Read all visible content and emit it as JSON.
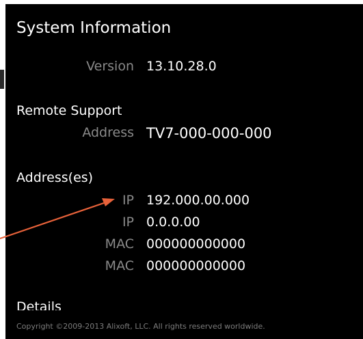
{
  "panel": {
    "title": "System Information",
    "version_label": "Version",
    "version_value": "13.10.28.0",
    "remote_support": {
      "heading": "Remote Support",
      "address_label": "Address",
      "address_value": "TV7-000-000-000"
    },
    "addresses": {
      "heading": "Address(es)",
      "rows": [
        {
          "label": "IP",
          "value": "192.000.00.000"
        },
        {
          "label": "IP",
          "value": "0.0.0.00"
        },
        {
          "label": "MAC",
          "value": "000000000000"
        },
        {
          "label": "MAC",
          "value": "000000000000"
        }
      ]
    },
    "details_heading": "Details",
    "copyright": "Copyright ©2009-2013 Alixoft, LLC. All rights reserved worldwide."
  },
  "colors": {
    "panel_bg": "#000000",
    "label_gray": "#8a8a8a",
    "annotation_arrow": "#e8623a"
  }
}
